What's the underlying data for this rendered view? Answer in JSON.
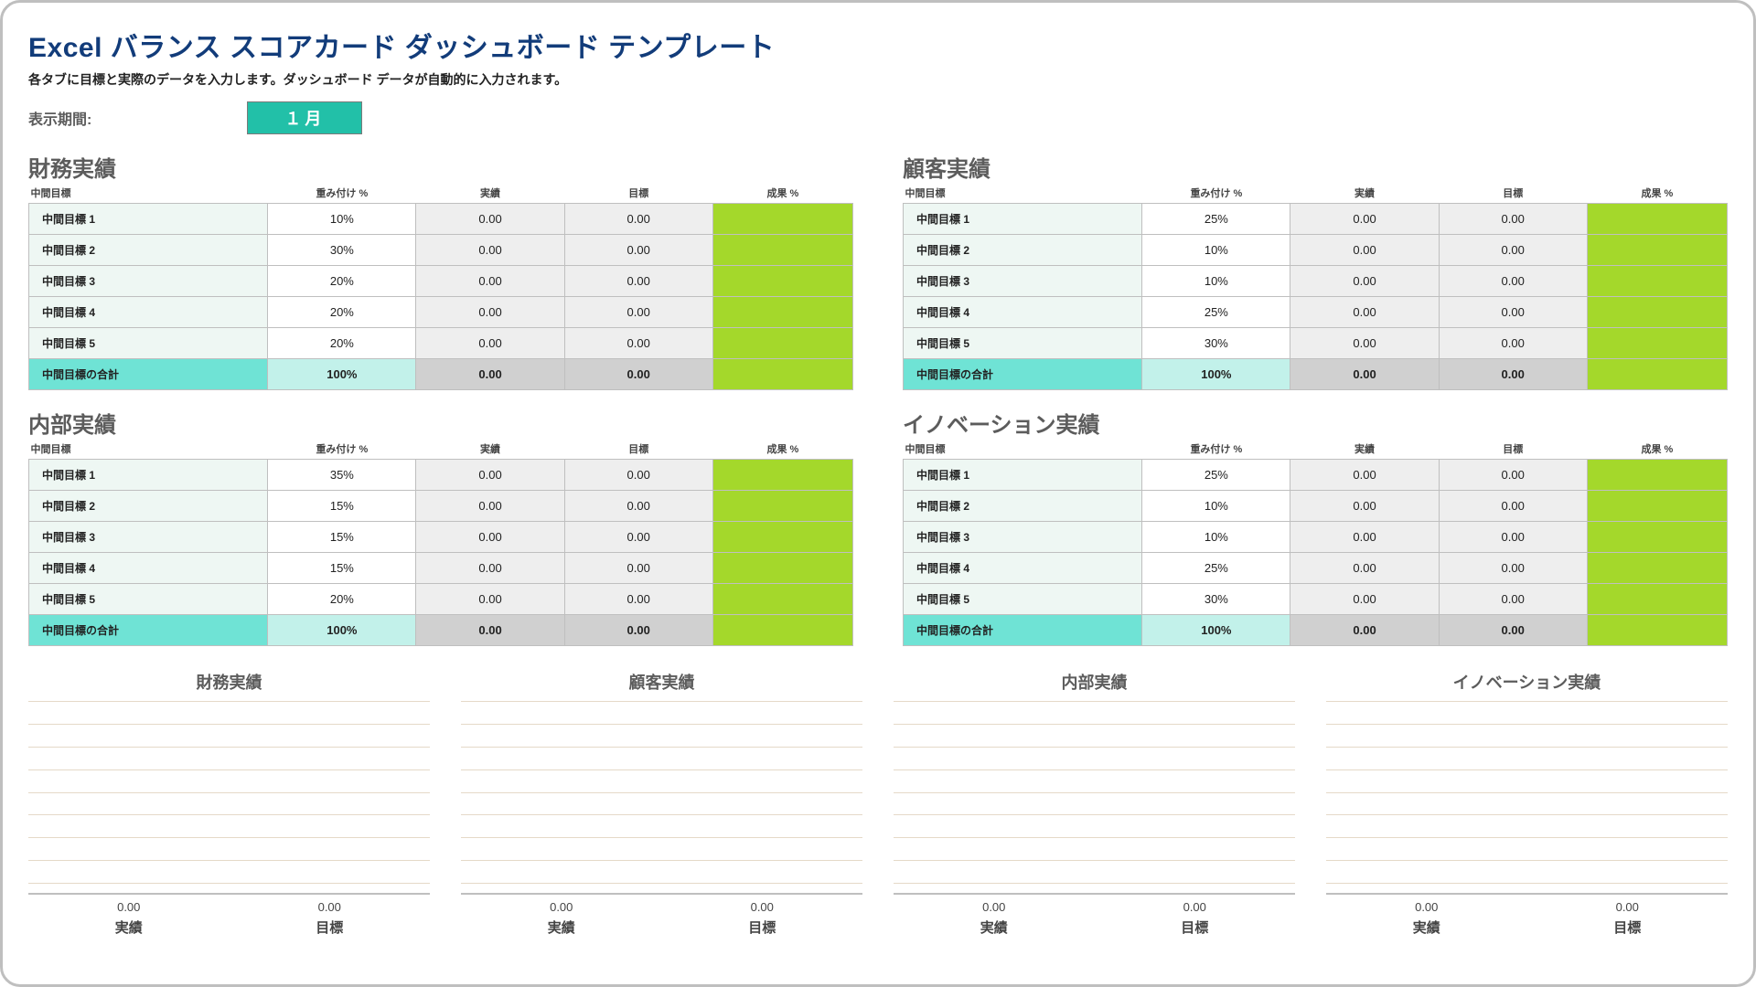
{
  "title": "Excel バランス スコアカード ダッシュボード テンプレート",
  "subtitle": "各タブに目標と実際のデータを入力します。ダッシュボード データが自動的に入力されます。",
  "period_label": "表示期間:",
  "period_value": "１月",
  "columns": {
    "sub": "中間目標",
    "weight": "重み付け %",
    "actual": "実績",
    "target": "目標",
    "result": "成果 %"
  },
  "total_label": "中間目標の合計",
  "section_ids": [
    "financial",
    "customer",
    "internal",
    "innovation"
  ],
  "sections": {
    "financial": {
      "title": "財務実績",
      "rows": [
        {
          "name": "中間目標 1",
          "weight": "10%",
          "actual": "0.00",
          "target": "0.00",
          "result": ""
        },
        {
          "name": "中間目標 2",
          "weight": "30%",
          "actual": "0.00",
          "target": "0.00",
          "result": ""
        },
        {
          "name": "中間目標 3",
          "weight": "20%",
          "actual": "0.00",
          "target": "0.00",
          "result": ""
        },
        {
          "name": "中間目標 4",
          "weight": "20%",
          "actual": "0.00",
          "target": "0.00",
          "result": ""
        },
        {
          "name": "中間目標 5",
          "weight": "20%",
          "actual": "0.00",
          "target": "0.00",
          "result": ""
        }
      ],
      "total": {
        "weight": "100%",
        "actual": "0.00",
        "target": "0.00",
        "result": ""
      }
    },
    "customer": {
      "title": "顧客実績",
      "rows": [
        {
          "name": "中間目標 1",
          "weight": "25%",
          "actual": "0.00",
          "target": "0.00",
          "result": ""
        },
        {
          "name": "中間目標 2",
          "weight": "10%",
          "actual": "0.00",
          "target": "0.00",
          "result": ""
        },
        {
          "name": "中間目標 3",
          "weight": "10%",
          "actual": "0.00",
          "target": "0.00",
          "result": ""
        },
        {
          "name": "中間目標 4",
          "weight": "25%",
          "actual": "0.00",
          "target": "0.00",
          "result": ""
        },
        {
          "name": "中間目標 5",
          "weight": "30%",
          "actual": "0.00",
          "target": "0.00",
          "result": ""
        }
      ],
      "total": {
        "weight": "100%",
        "actual": "0.00",
        "target": "0.00",
        "result": ""
      }
    },
    "internal": {
      "title": "内部実績",
      "rows": [
        {
          "name": "中間目標 1",
          "weight": "35%",
          "actual": "0.00",
          "target": "0.00",
          "result": ""
        },
        {
          "name": "中間目標 2",
          "weight": "15%",
          "actual": "0.00",
          "target": "0.00",
          "result": ""
        },
        {
          "name": "中間目標 3",
          "weight": "15%",
          "actual": "0.00",
          "target": "0.00",
          "result": ""
        },
        {
          "name": "中間目標 4",
          "weight": "15%",
          "actual": "0.00",
          "target": "0.00",
          "result": ""
        },
        {
          "name": "中間目標 5",
          "weight": "20%",
          "actual": "0.00",
          "target": "0.00",
          "result": ""
        }
      ],
      "total": {
        "weight": "100%",
        "actual": "0.00",
        "target": "0.00",
        "result": ""
      }
    },
    "innovation": {
      "title": "イノベーション実績",
      "rows": [
        {
          "name": "中間目標 1",
          "weight": "25%",
          "actual": "0.00",
          "target": "0.00",
          "result": ""
        },
        {
          "name": "中間目標 2",
          "weight": "10%",
          "actual": "0.00",
          "target": "0.00",
          "result": ""
        },
        {
          "name": "中間目標 3",
          "weight": "10%",
          "actual": "0.00",
          "target": "0.00",
          "result": ""
        },
        {
          "name": "中間目標 4",
          "weight": "25%",
          "actual": "0.00",
          "target": "0.00",
          "result": ""
        },
        {
          "name": "中間目標 5",
          "weight": "30%",
          "actual": "0.00",
          "target": "0.00",
          "result": ""
        }
      ],
      "total": {
        "weight": "100%",
        "actual": "0.00",
        "target": "0.00",
        "result": ""
      }
    }
  },
  "charts": [
    {
      "title": "財務実績",
      "actual_value": "0.00",
      "target_value": "0.00",
      "actual_label": "実績",
      "target_label": "目標"
    },
    {
      "title": "顧客実績",
      "actual_value": "0.00",
      "target_value": "0.00",
      "actual_label": "実績",
      "target_label": "目標"
    },
    {
      "title": "内部実績",
      "actual_value": "0.00",
      "target_value": "0.00",
      "actual_label": "実績",
      "target_label": "目標"
    },
    {
      "title": "イノベーション実績",
      "actual_value": "0.00",
      "target_value": "0.00",
      "actual_label": "実績",
      "target_label": "目標"
    }
  ],
  "chart_data": [
    {
      "type": "bar",
      "title": "財務実績",
      "categories": [
        "実績",
        "目標"
      ],
      "values": [
        0.0,
        0.0
      ],
      "xlabel": "",
      "ylabel": "",
      "ylim": [
        0,
        1
      ]
    },
    {
      "type": "bar",
      "title": "顧客実績",
      "categories": [
        "実績",
        "目標"
      ],
      "values": [
        0.0,
        0.0
      ],
      "xlabel": "",
      "ylabel": "",
      "ylim": [
        0,
        1
      ]
    },
    {
      "type": "bar",
      "title": "内部実績",
      "categories": [
        "実績",
        "目標"
      ],
      "values": [
        0.0,
        0.0
      ],
      "xlabel": "",
      "ylabel": "",
      "ylim": [
        0,
        1
      ]
    },
    {
      "type": "bar",
      "title": "イノベーション実績",
      "categories": [
        "実績",
        "目標"
      ],
      "values": [
        0.0,
        0.0
      ],
      "xlabel": "",
      "ylabel": "",
      "ylim": [
        0,
        1
      ]
    }
  ],
  "chart_gridlines": 9
}
